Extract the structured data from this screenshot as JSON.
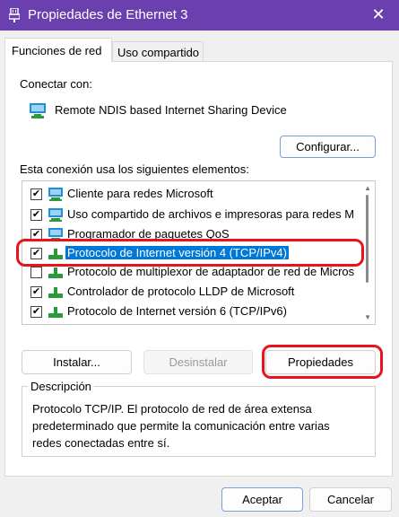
{
  "window": {
    "title": "Propiedades de Ethernet 3",
    "close_glyph": "✕"
  },
  "tabs": [
    {
      "label": "Funciones de red",
      "active": true
    },
    {
      "label": "Uso compartido",
      "active": false
    }
  ],
  "connect": {
    "label": "Conectar con:",
    "device_name": "Remote NDIS based Internet Sharing Device",
    "configure_button": "Configurar..."
  },
  "components": {
    "label": "Esta conexión usa los siguientes elementos:",
    "items": [
      {
        "label": "Cliente para redes Microsoft",
        "checked": true,
        "icon": "client-network-icon",
        "selected": false
      },
      {
        "label": "Uso compartido de archivos e impresoras para redes M",
        "checked": true,
        "icon": "file-sharing-icon",
        "selected": false
      },
      {
        "label": "Programador de paquetes QoS",
        "checked": true,
        "icon": "service-icon",
        "selected": false
      },
      {
        "label": "Protocolo de Internet versión 4 (TCP/IPv4)",
        "checked": true,
        "icon": "protocol-icon",
        "selected": true
      },
      {
        "label": "Protocolo de multiplexor de adaptador de red de Micros",
        "checked": false,
        "icon": "protocol-icon",
        "selected": false
      },
      {
        "label": "Controlador de protocolo LLDP de Microsoft",
        "checked": true,
        "icon": "protocol-icon",
        "selected": false
      },
      {
        "label": "Protocolo de Internet versión 6 (TCP/IPv6)",
        "checked": true,
        "icon": "protocol-icon",
        "selected": false
      }
    ],
    "check_glyph": "✔"
  },
  "actions": {
    "install": "Instalar...",
    "uninstall": "Desinstalar",
    "properties": "Propiedades"
  },
  "description": {
    "title": "Descripción",
    "lines": [
      "Protocolo TCP/IP. El protocolo de red de área extensa",
      "predeterminado que permite la comunicación entre varias",
      "redes conectadas entre sí."
    ]
  },
  "footer": {
    "accept": "Aceptar",
    "cancel": "Cancelar"
  },
  "colors": {
    "titlebar": "#6c3fae",
    "selection": "#0078d7",
    "annotation": "#e8141b"
  }
}
